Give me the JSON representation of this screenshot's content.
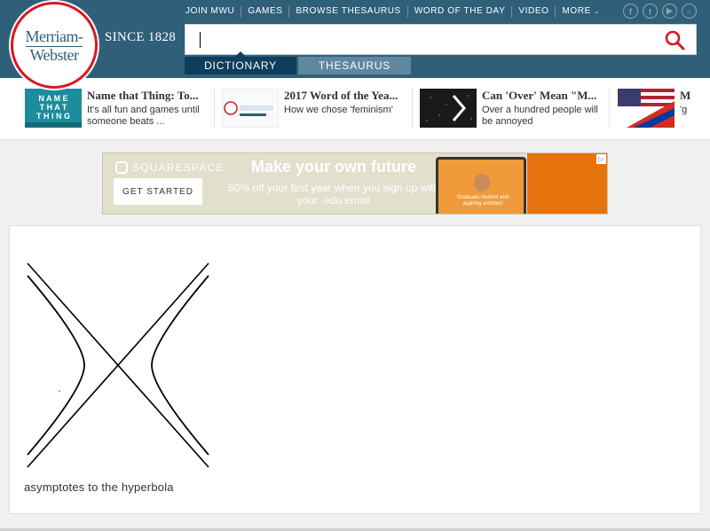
{
  "header": {
    "logo_line1": "Merriam-",
    "logo_line2": "Webster",
    "since": "SINCE 1828",
    "nav": [
      "JOIN MWU",
      "GAMES",
      "BROWSE THESAURUS",
      "WORD OF THE DAY",
      "VIDEO",
      "MORE"
    ],
    "social": [
      "facebook-icon",
      "twitter-icon",
      "youtube-icon",
      "instagram-icon"
    ]
  },
  "search": {
    "value": "",
    "placeholder": ""
  },
  "tabs": {
    "dictionary": "DICTIONARY",
    "thesaurus": "THESAURUS"
  },
  "promos": [
    {
      "title": "Name that Thing: To...",
      "subtitle": "It's all fun and games until someone beats ..."
    },
    {
      "title": "2017 Word of the Yea...",
      "subtitle": "How we chose 'feminism'"
    },
    {
      "title": "Can 'Over' Mean \"M...",
      "subtitle": "Over a hundred people will be annoyed"
    },
    {
      "title": "M",
      "subtitle": "'g"
    }
  ],
  "ad": {
    "brand": "SQUARESPACE",
    "button": "GET STARTED",
    "headline": "Make your own future",
    "subline": "50% off your first year when you sign up with your .edu email",
    "photo_caption": "Graduate student and aspiring architect"
  },
  "figure": {
    "caption": "asymptotes to the hyperbola"
  },
  "colors": {
    "brand_blue": "#305f7a",
    "tab_active": "#0f3d5c",
    "tab_inactive": "#5f879e",
    "logo_red": "#d71920"
  }
}
